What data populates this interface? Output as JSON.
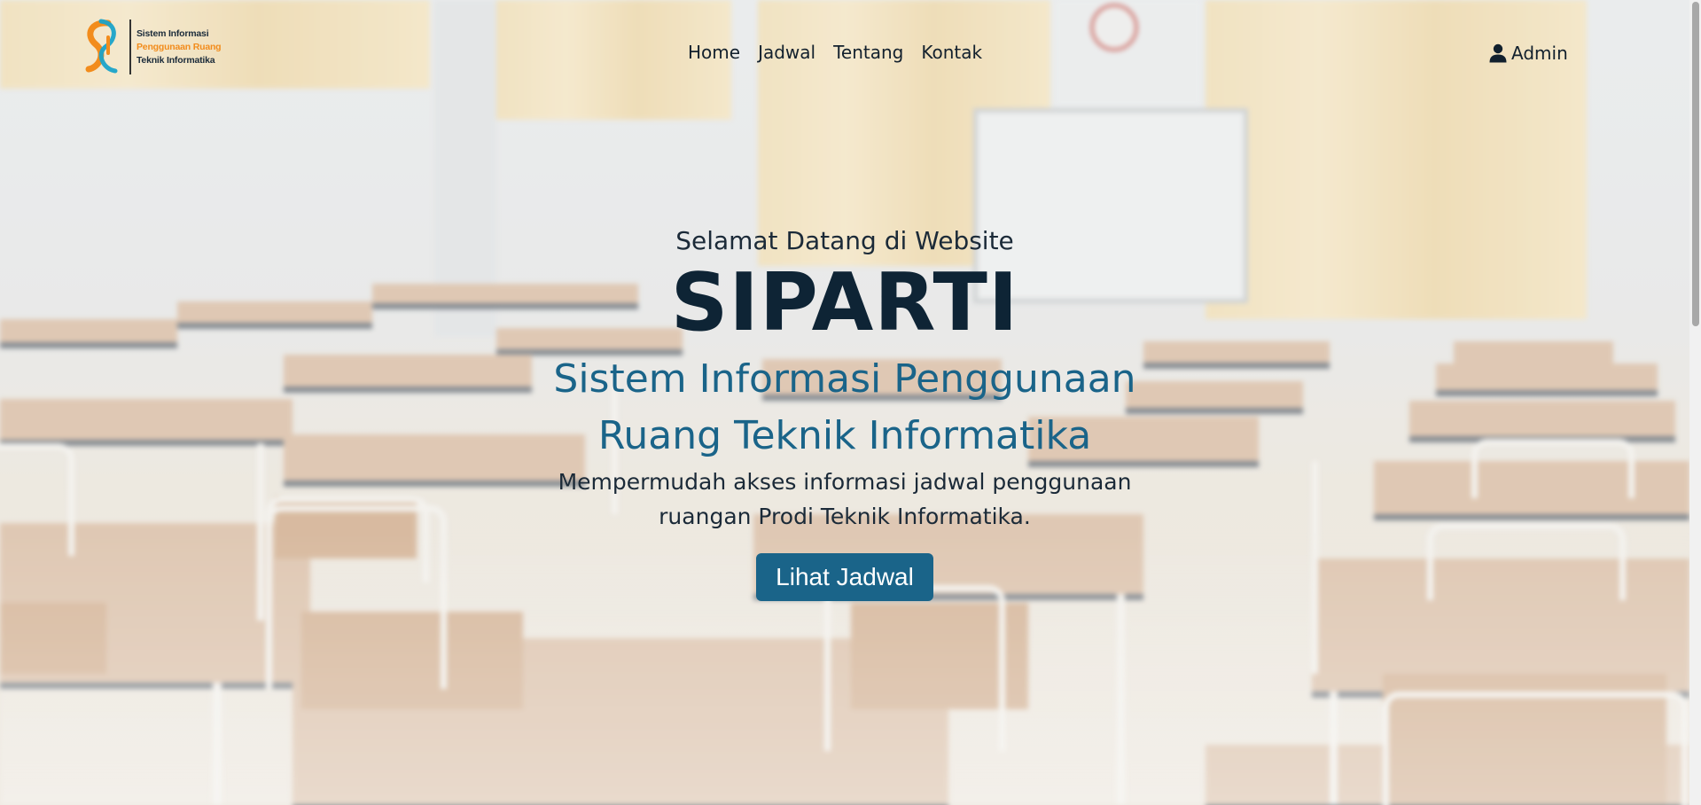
{
  "brand_logo": {
    "line1": "Sistem Informasi",
    "line2": "Penggunaan Ruang",
    "line3": "Teknik Informatika",
    "colors": {
      "orange": "#f28c1c",
      "teal": "#1aa3c9",
      "dark": "#1b2b3a"
    }
  },
  "nav": {
    "items": [
      {
        "label": "Home"
      },
      {
        "label": "Jadwal"
      },
      {
        "label": "Tentang"
      },
      {
        "label": "Kontak"
      }
    ],
    "admin_icon": "user-icon",
    "admin_label": "Admin"
  },
  "hero": {
    "welcome": "Selamat Datang di Website",
    "title": "SIPARTI",
    "subtitle": "Sistem Informasi Penggunaan Ruang Teknik Informatika",
    "description": "Mempermudah akses informasi jadwal penggunaan ruangan Prodi Teknik Informatika.",
    "cta_label": "Lihat Jadwal"
  },
  "theme": {
    "primary": "#1a6489",
    "heading": "#0e2435",
    "text": "#1b2a38"
  }
}
